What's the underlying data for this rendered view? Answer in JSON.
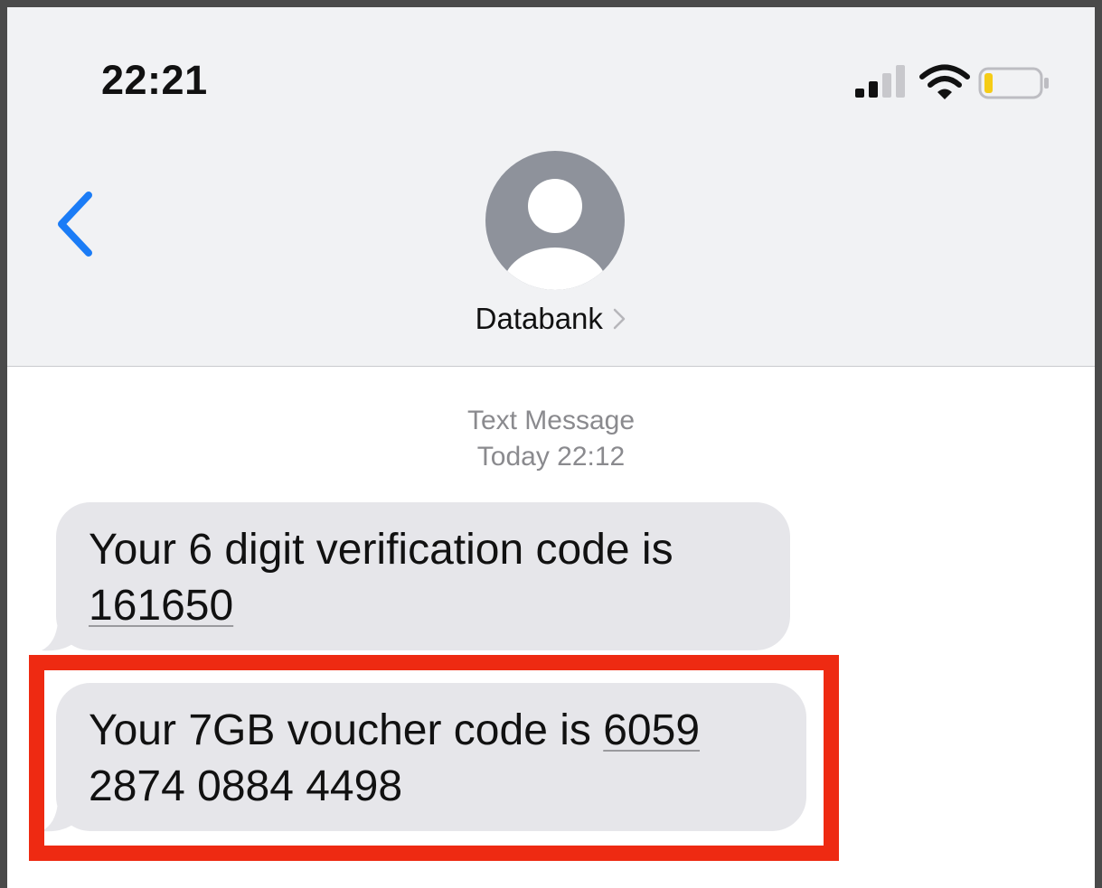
{
  "status_bar": {
    "time": "22:21",
    "icons": [
      "cellular-signal-icon",
      "wifi-icon",
      "battery-icon"
    ],
    "battery_level": 0.1
  },
  "header": {
    "contact_name": "Databank",
    "back_icon": "chevron-left-icon",
    "avatar_icon": "person-placeholder-icon",
    "accent_color": "#1b7cf6"
  },
  "conversation": {
    "service_label": "Text Message",
    "timestamp": "Today 22:12",
    "messages": [
      {
        "text_before_code": "Your 6 digit verification code is ",
        "code": "161650",
        "text_after_code": ""
      },
      {
        "text_before_code": "Your 7GB voucher code is ",
        "code": "6059",
        "text_after_code": " 2874 0884 4498"
      }
    ]
  },
  "annotation": {
    "highlight_color": "#ee2a12"
  }
}
